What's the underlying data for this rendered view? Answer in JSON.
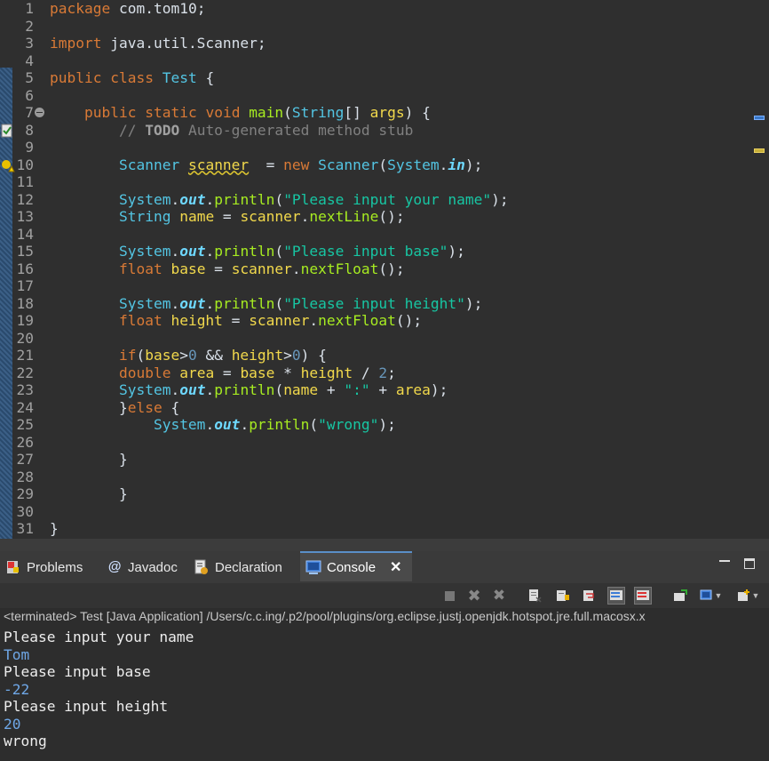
{
  "editor": {
    "lines": [
      {
        "n": "1",
        "t": "package com.tom10;"
      },
      {
        "n": "2",
        "t": ""
      },
      {
        "n": "3",
        "t": "import java.util.Scanner;"
      },
      {
        "n": "4",
        "t": ""
      },
      {
        "n": "5",
        "t": "public class Test {"
      },
      {
        "n": "6",
        "t": ""
      },
      {
        "n": "7",
        "t": "    public static void main(String[] args) {"
      },
      {
        "n": "8",
        "t": "        // TODO Auto-generated method stub"
      },
      {
        "n": "9",
        "t": ""
      },
      {
        "n": "10",
        "t": "        Scanner scanner  = new Scanner(System.in);"
      },
      {
        "n": "11",
        "t": ""
      },
      {
        "n": "12",
        "t": "        System.out.println(\"Please input your name\");"
      },
      {
        "n": "13",
        "t": "        String name = scanner.nextLine();"
      },
      {
        "n": "14",
        "t": ""
      },
      {
        "n": "15",
        "t": "        System.out.println(\"Please input base\");"
      },
      {
        "n": "16",
        "t": "        float base = scanner.nextFloat();"
      },
      {
        "n": "17",
        "t": ""
      },
      {
        "n": "18",
        "t": "        System.out.println(\"Please input height\");"
      },
      {
        "n": "19",
        "t": "        float height = scanner.nextFloat();"
      },
      {
        "n": "20",
        "t": ""
      },
      {
        "n": "21",
        "t": "        if(base>0 && height>0) {"
      },
      {
        "n": "22",
        "t": "        double area = base * height / 2;"
      },
      {
        "n": "23",
        "t": "        System.out.println(name + \":\" + area);"
      },
      {
        "n": "24",
        "t": "        }else {"
      },
      {
        "n": "25",
        "t": "            System.out.println(\"wrong\");"
      },
      {
        "n": "26",
        "t": ""
      },
      {
        "n": "27",
        "t": "        }"
      },
      {
        "n": "28",
        "t": ""
      },
      {
        "n": "29",
        "t": "        }"
      },
      {
        "n": "30",
        "t": ""
      },
      {
        "n": "31",
        "t": "}"
      }
    ]
  },
  "tabs": [
    {
      "label": "Problems",
      "icon": "problems-icon"
    },
    {
      "label": "Javadoc",
      "icon": "at-sign-icon"
    },
    {
      "label": "Declaration",
      "icon": "declaration-icon"
    },
    {
      "label": "Console",
      "icon": "console-icon",
      "active": true
    }
  ],
  "console": {
    "status": "<terminated> Test [Java Application] /Users/c.c.ing/.p2/pool/plugins/org.eclipse.justj.openjdk.hotspot.jre.full.macosx.x",
    "output": [
      {
        "text": "Please input your name",
        "kind": "std"
      },
      {
        "text": "Tom",
        "kind": "in"
      },
      {
        "text": "Please input base",
        "kind": "std"
      },
      {
        "text": "-22",
        "kind": "in"
      },
      {
        "text": "Please input height",
        "kind": "std"
      },
      {
        "text": "20",
        "kind": "in"
      },
      {
        "text": "wrong",
        "kind": "std"
      }
    ]
  },
  "colors": {
    "keyword": "#d97a36",
    "type": "#53c5e3",
    "string": "#17c6a3",
    "method": "#a7ec21",
    "accent": "#5a8fc8"
  }
}
